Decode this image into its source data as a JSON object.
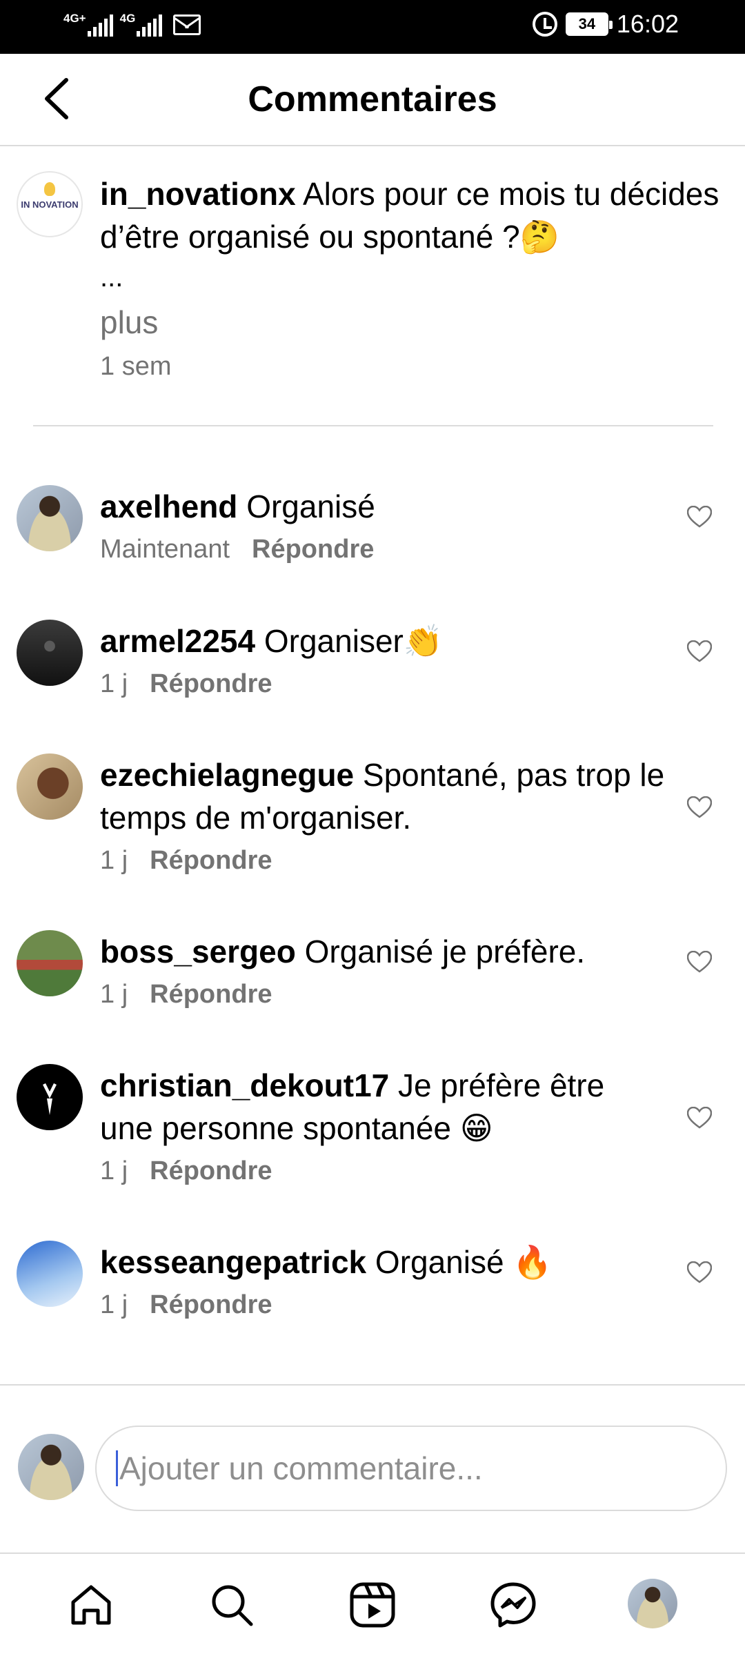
{
  "status_bar": {
    "network1": "4G+",
    "network2": "4G",
    "battery": "34",
    "time": "16:02",
    "icons": [
      "signal-icon",
      "mail-icon",
      "alarm-icon",
      "battery-icon"
    ]
  },
  "header": {
    "title": "Commentaires",
    "back_icon": "chevron-left-icon"
  },
  "caption": {
    "username": "in_novationx",
    "avatar_text": "IN NOVATION",
    "text": "Alors pour ce mois tu décides d’être organisé ou spontané ?",
    "emoji": "🤔",
    "ellipsis": "...",
    "more": "plus",
    "time": "1 sem"
  },
  "comments": [
    {
      "username": "axelhend",
      "text": "Organisé",
      "emoji": "",
      "time": "Maintenant",
      "reply": "Répondre"
    },
    {
      "username": "armel2254",
      "text": "Organiser",
      "emoji": "👏",
      "time": "1 j",
      "reply": "Répondre"
    },
    {
      "username": "ezechielagnegue",
      "text": "Spontané, pas trop le temps de m'organiser.",
      "emoji": "",
      "time": "1 j",
      "reply": "Répondre"
    },
    {
      "username": "boss_sergeo",
      "text": "Organisé je préfère.",
      "emoji": "",
      "time": "1 j",
      "reply": "Répondre"
    },
    {
      "username": "christian_dekout17",
      "text": "Je préfère être une personne spontanée",
      "emoji": "😁",
      "time": "1 j",
      "reply": "Répondre"
    },
    {
      "username": "kesseangepatrick",
      "text": "Organisé",
      "emoji": "🔥",
      "time": "1 j",
      "reply": "Répondre"
    }
  ],
  "input": {
    "placeholder": "Ajouter un commentaire..."
  },
  "bottom_nav": [
    "home-icon",
    "search-icon",
    "reels-icon",
    "messenger-icon",
    "profile-avatar"
  ],
  "colors": {
    "text": "#000000",
    "secondary": "#737373",
    "divider": "#dbdbdb",
    "caret": "#3a5fd9"
  }
}
